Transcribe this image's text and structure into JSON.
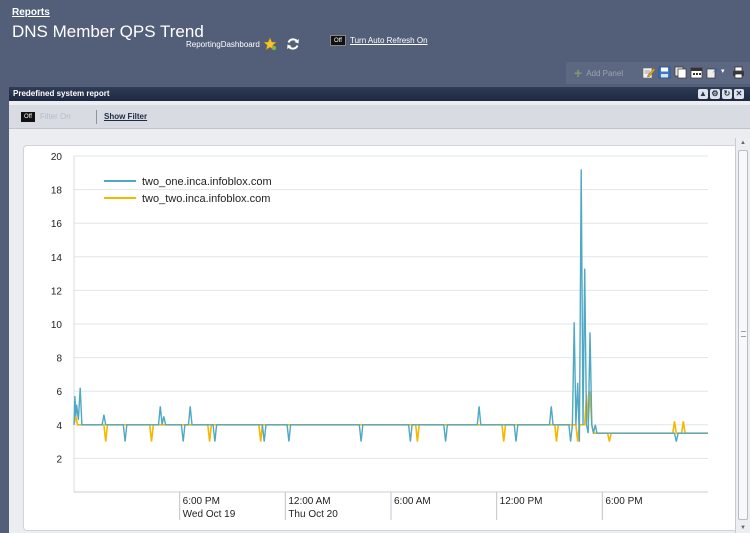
{
  "header": {
    "breadcrumb": "Reports",
    "title": "DNS Member QPS Trend",
    "dashboard_label": "ReportingDashboard",
    "auto_refresh_toggle": "Off",
    "auto_refresh_link": "Turn Auto Refresh On"
  },
  "toolbar": {
    "add_panel_label": "Add Panel",
    "icons": [
      "edit-icon",
      "save-icon",
      "copy-icon",
      "schedule-icon",
      "export-icon",
      "dropdown-arrow-icon",
      "print-icon"
    ]
  },
  "panel": {
    "title": "Predefined system report",
    "controls": [
      "collapse-icon",
      "settings-icon",
      "refresh-icon",
      "close-icon"
    ],
    "filter_toggle": "Off",
    "filter_label": "Filter On",
    "show_filter": "Show Filter"
  },
  "colors": {
    "header_bg": "#535f79",
    "series_one": "#4fa8c4",
    "series_two": "#f5b800"
  },
  "chart_data": {
    "type": "line",
    "title": "",
    "xlabel": "",
    "ylabel": "",
    "ylim": [
      0,
      20
    ],
    "xlim": [
      0,
      36
    ],
    "x_unit": "hours after 12:00 PM Wed Oct 19",
    "yticks": [
      "2",
      "4",
      "6",
      "8",
      "10",
      "12",
      "14",
      "16",
      "18",
      "20"
    ],
    "xticks": [
      {
        "x": 6,
        "label": "6:00 PM",
        "sub": "Wed Oct 19"
      },
      {
        "x": 12,
        "label": "12:00 AM",
        "sub": "Thu Oct 20"
      },
      {
        "x": 18,
        "label": "6:00 AM",
        "sub": ""
      },
      {
        "x": 24,
        "label": "12:00 PM",
        "sub": ""
      },
      {
        "x": 30,
        "label": "6:00 PM",
        "sub": ""
      }
    ],
    "grid": "horizontal",
    "legend_position": "top-left",
    "series": [
      {
        "name": "two_one.inca.infoblox.com",
        "color": "#4fa8c4",
        "x": [
          0,
          0.05,
          0.1,
          0.15,
          0.25,
          0.35,
          0.45,
          0.55,
          1.6,
          1.7,
          1.8,
          2.8,
          2.9,
          3.0,
          4.8,
          4.9,
          5.0,
          5.1,
          5.2,
          6.1,
          6.2,
          6.3,
          6.5,
          6.6,
          6.7,
          7.9,
          8.0,
          8.1,
          10.7,
          10.8,
          10.9,
          12.1,
          12.2,
          12.3,
          16.2,
          16.3,
          16.4,
          19.0,
          19.1,
          19.2,
          21.0,
          21.1,
          21.2,
          22.9,
          23.0,
          23.1,
          25.0,
          25.1,
          25.2,
          27.0,
          27.1,
          27.2,
          28.1,
          28.2,
          28.3,
          28.4,
          28.5,
          28.6,
          28.7,
          28.8,
          28.9,
          29.0,
          29.1,
          29.2,
          29.3,
          29.4,
          29.5,
          29.6,
          29.7,
          29.8,
          31.5,
          31.6,
          34.1,
          34.2,
          34.3,
          36
        ],
        "y": [
          4,
          5.7,
          4.5,
          5.2,
          4.3,
          6.2,
          4,
          4,
          4,
          4.6,
          4,
          4,
          3,
          4,
          4,
          5.1,
          4,
          4.5,
          4,
          4,
          3,
          4,
          4,
          5.1,
          4,
          4,
          3,
          4,
          4,
          3,
          4,
          4,
          3,
          4,
          4,
          3,
          4,
          4,
          3,
          4,
          4,
          3,
          4,
          4,
          5.1,
          4,
          4,
          3,
          4,
          4,
          5.1,
          4,
          4,
          3,
          4,
          10.1,
          4,
          6.5,
          3,
          19.2,
          4,
          13.3,
          4,
          3.5,
          9.5,
          4,
          3.5,
          4,
          3.5,
          3.5,
          3.5,
          3.5,
          3.5,
          3.0,
          3.5,
          3.5
        ]
      },
      {
        "name": "two_two.inca.infoblox.com",
        "color": "#f5b800",
        "x": [
          0,
          0.1,
          0.2,
          0.3,
          1.7,
          1.8,
          1.9,
          4.3,
          4.4,
          4.5,
          7.6,
          7.7,
          7.8,
          10.5,
          10.6,
          10.7,
          19.4,
          19.5,
          19.6,
          24.3,
          24.4,
          24.5,
          27.3,
          27.4,
          27.5,
          28.5,
          28.6,
          28.7,
          29.0,
          29.1,
          29.2,
          29.3,
          29.4,
          29.5,
          29.6,
          30.3,
          30.4,
          30.5,
          34.0,
          34.1,
          34.2,
          34.5,
          34.6,
          34.7,
          36
        ],
        "y": [
          4,
          4.5,
          4,
          4,
          4,
          3,
          4,
          4,
          3,
          4,
          4,
          3,
          4,
          4,
          3,
          4,
          4,
          3,
          4,
          4,
          3,
          4,
          4,
          3,
          4,
          4,
          3,
          4,
          4,
          5.8,
          4.2,
          6.0,
          4,
          3.5,
          3.5,
          3.5,
          3.0,
          3.5,
          3.5,
          4.2,
          3.5,
          3.5,
          4.2,
          3.5,
          3.5
        ]
      }
    ]
  }
}
